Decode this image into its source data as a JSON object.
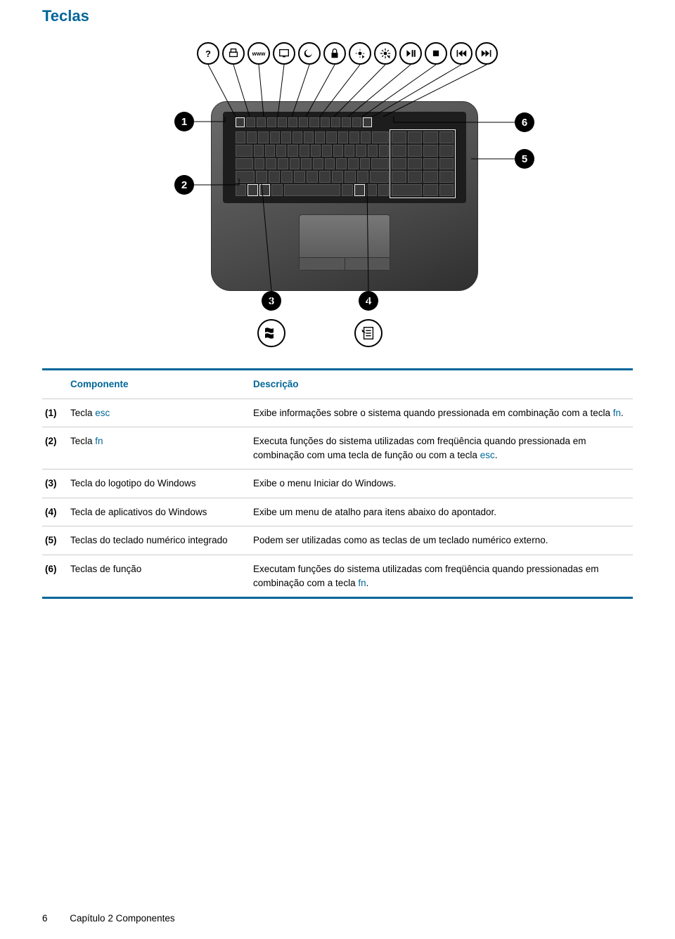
{
  "title": "Teclas",
  "table": {
    "header": {
      "component": "Componente",
      "description": "Descrição"
    },
    "rows": [
      {
        "num": "(1)",
        "component_plain": "Tecla ",
        "component_link": "esc",
        "desc_plain": "Exibe informações sobre o sistema quando pressionada em combinação com a tecla ",
        "desc_link": "fn",
        "desc_tail": "."
      },
      {
        "num": "(2)",
        "component_plain": "Tecla ",
        "component_link": "fn",
        "desc_plain": "Executa funções do sistema utilizadas com freqüência quando pressionada em combinação com uma tecla de função ou com a tecla ",
        "desc_link": "esc",
        "desc_tail": "."
      },
      {
        "num": "(3)",
        "component_plain": "Tecla do logotipo do Windows",
        "component_link": "",
        "desc_plain": "Exibe o menu Iniciar do Windows.",
        "desc_link": "",
        "desc_tail": ""
      },
      {
        "num": "(4)",
        "component_plain": "Tecla de aplicativos do Windows",
        "component_link": "",
        "desc_plain": "Exibe um menu de atalho para itens abaixo do apontador.",
        "desc_link": "",
        "desc_tail": ""
      },
      {
        "num": "(5)",
        "component_plain": "Teclas do teclado numérico integrado",
        "component_link": "",
        "desc_plain": "Podem ser utilizadas como as teclas de um teclado numérico externo.",
        "desc_link": "",
        "desc_tail": ""
      },
      {
        "num": "(6)",
        "component_plain": "Teclas de função",
        "component_link": "",
        "desc_plain": "Executam funções do sistema utilizadas com freqüência quando pressionadas em combinação com a tecla ",
        "desc_link": "fn",
        "desc_tail": "."
      }
    ]
  },
  "icons": {
    "i0": "?",
    "i2": "www",
    "i9": "■"
  },
  "callouts": {
    "c1": "1",
    "c2": "2",
    "c3": "3",
    "c4": "4",
    "c5": "5",
    "c6": "6"
  },
  "footer": {
    "page_number": "6",
    "chapter": "Capítulo 2   Componentes"
  }
}
